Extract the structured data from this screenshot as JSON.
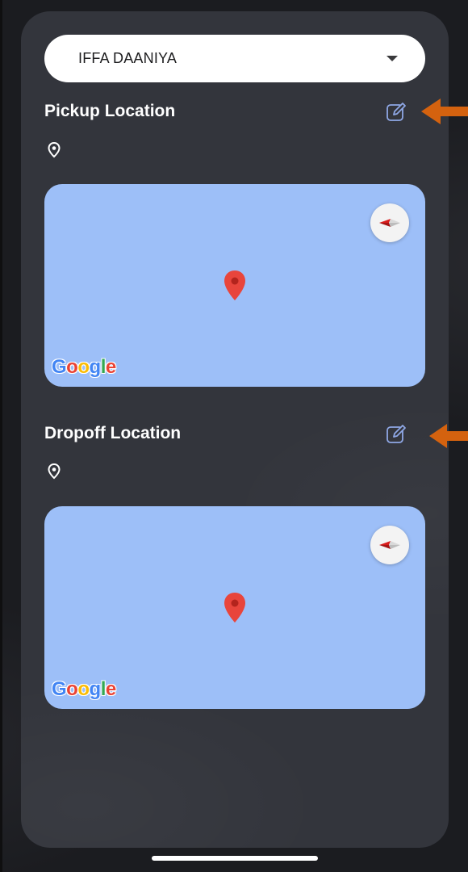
{
  "customer_select": {
    "selected": "IFFA DAANIYA"
  },
  "pickup": {
    "title": "Pickup Location",
    "address": ""
  },
  "dropoff": {
    "title": "Dropoff Location",
    "address": ""
  },
  "map": {
    "logo": "Google"
  },
  "colors": {
    "card": "#33353c",
    "map": "#9dbff8",
    "pin": "#e8453c",
    "edit_icon": "#8fa8e6",
    "arrow": "#d4620f"
  },
  "icons": [
    "chevron-down-icon",
    "edit-icon",
    "location-pin-icon",
    "compass-icon",
    "map-marker-icon",
    "arrow-left-icon"
  ]
}
